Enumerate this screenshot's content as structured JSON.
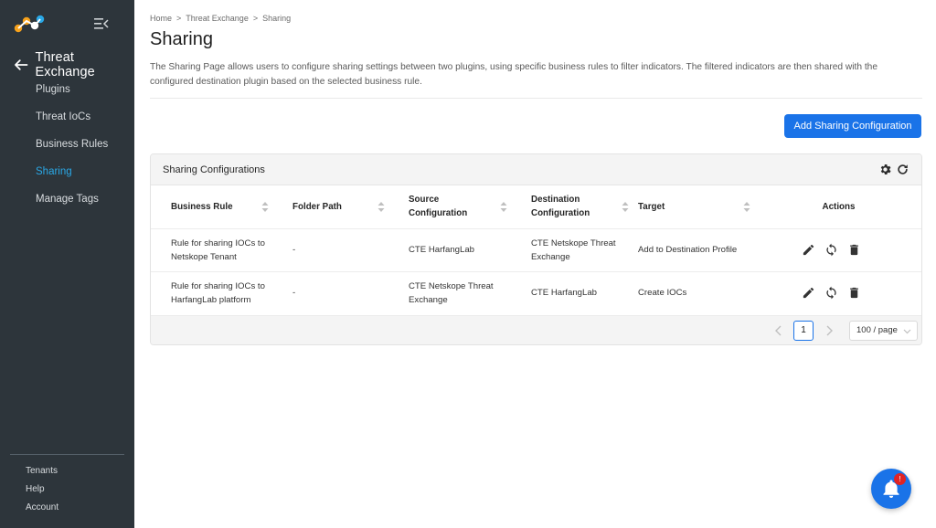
{
  "sidebar": {
    "back_title": "Threat Exchange",
    "items": [
      {
        "label": "Plugins",
        "active": false
      },
      {
        "label": "Threat IoCs",
        "active": false
      },
      {
        "label": "Business Rules",
        "active": false
      },
      {
        "label": "Sharing",
        "active": true
      },
      {
        "label": "Manage Tags",
        "active": false
      }
    ],
    "bottom": [
      "Tenants",
      "Help",
      "Account"
    ],
    "accent_color": "#2aa8e6"
  },
  "breadcrumb": [
    "Home",
    "Threat Exchange",
    "Sharing"
  ],
  "breadcrumb_sep": ">",
  "page": {
    "title": "Sharing",
    "description": "The Sharing Page allows users to configure sharing settings between two plugins, using specific business rules to filter indicators. The filtered indicators are then shared with the configured destination plugin based on the selected business rule.",
    "add_button": "Add Sharing Configuration"
  },
  "card": {
    "title": "Sharing Configurations",
    "columns": [
      "Business Rule",
      "Folder Path",
      "Source Configuration",
      "Destination Configuration",
      "Target",
      "Actions"
    ],
    "rows": [
      {
        "business_rule": "Rule for sharing IOCs to Netskope Tenant",
        "folder_path": "-",
        "source": "CTE HarfangLab",
        "destination": "CTE Netskope Threat Exchange",
        "target": "Add to Destination Profile"
      },
      {
        "business_rule": "Rule for sharing IOCs to HarfangLab platform",
        "folder_path": "-",
        "source": "CTE Netskope Threat Exchange",
        "destination": "CTE HarfangLab",
        "target": "Create IOCs"
      }
    ],
    "pagination": {
      "current_page": "1",
      "page_size": "100 / page"
    }
  },
  "notification": {
    "badge": "!"
  },
  "colors": {
    "primary": "#1a73e8",
    "sidebar_bg": "#2d353b",
    "badge": "#e02424"
  },
  "icons": [
    "logo-icon",
    "collapse-menu-icon",
    "back-arrow-icon",
    "gear-icon",
    "refresh-icon",
    "sort-icon",
    "edit-icon",
    "sync-icon",
    "delete-icon",
    "chevron-left-icon",
    "chevron-right-icon",
    "chevron-down-icon",
    "bell-icon"
  ]
}
